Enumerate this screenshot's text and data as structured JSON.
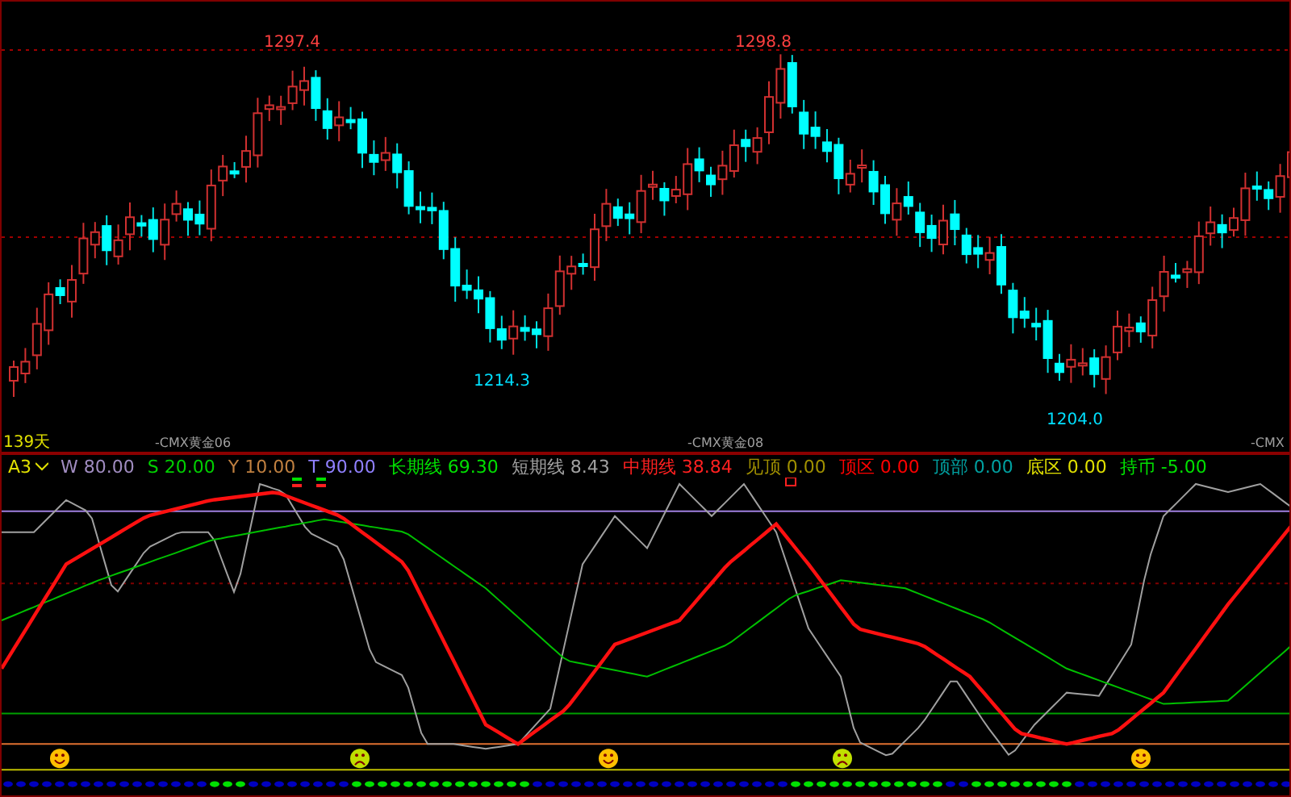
{
  "price_chart": {
    "price_labels": [
      {
        "text": "1297.4",
        "kind": "high"
      },
      {
        "text": "1298.8",
        "kind": "high"
      },
      {
        "text": "1214.3",
        "kind": "low"
      },
      {
        "text": "1204.0",
        "kind": "low"
      }
    ],
    "period": "139天",
    "contract_labels": [
      "-CMX黄金06",
      "-CMX黄金08",
      "-CMX"
    ]
  },
  "indicator": {
    "name": "A3",
    "params": [
      {
        "label": "W",
        "value": "80.00",
        "color": "#a08cc0"
      },
      {
        "label": "S",
        "value": "20.00",
        "color": "#00d000"
      },
      {
        "label": "Y",
        "value": "10.00",
        "color": "#c08040"
      },
      {
        "label": "T",
        "value": "90.00",
        "color": "#9080ff"
      },
      {
        "label": "长期线",
        "value": "69.30",
        "color": "#00e000"
      },
      {
        "label": "短期线",
        "value": "8.43",
        "color": "#a0a0a0"
      },
      {
        "label": "中期线",
        "value": "38.84",
        "color": "#ff2020"
      },
      {
        "label": "见顶",
        "value": "0.00",
        "color": "#a09000"
      },
      {
        "label": "顶区",
        "value": "0.00",
        "color": "#ff0000"
      },
      {
        "label": "顶部",
        "value": "0.00",
        "color": "#00a0a0"
      },
      {
        "label": "底区",
        "value": "0.00",
        "color": "#e0e000"
      },
      {
        "label": "持币",
        "value": "-5.00",
        "color": "#00e000"
      }
    ],
    "signals": [
      {
        "kind": "happy"
      },
      {
        "kind": "sad"
      },
      {
        "kind": "happy"
      },
      {
        "kind": "sad"
      },
      {
        "kind": "happy"
      }
    ]
  }
}
